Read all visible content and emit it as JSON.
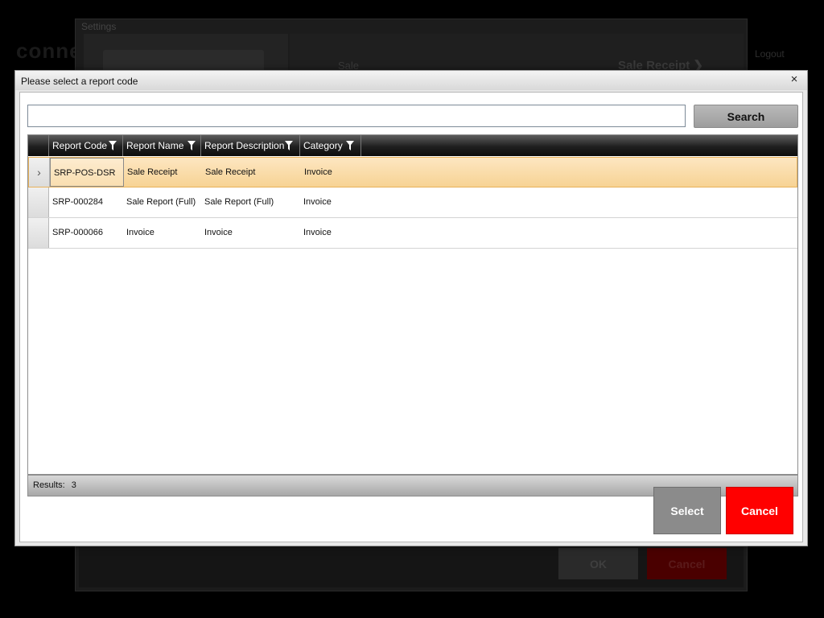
{
  "background": {
    "brand_text": "conne",
    "logout_label": "Logout",
    "settings_title": "Settings",
    "sale_label": "Sale",
    "sale_receipt_label": "Sale Receipt ❯",
    "ok_label": "OK",
    "cancel_label": "Cancel"
  },
  "dialog": {
    "title": "Please select a report code",
    "close_glyph": "×",
    "search": {
      "value": "",
      "placeholder": "",
      "button_label": "Search"
    },
    "grid": {
      "columns": [
        "Report Code",
        "Report Name",
        "Report Description",
        "Category"
      ],
      "rows": [
        {
          "code": "SRP-POS-DSR",
          "name": "Sale Receipt",
          "description": "Sale Receipt",
          "category": "Invoice",
          "selected": true
        },
        {
          "code": "SRP-000284",
          "name": "Sale Report (Full)",
          "description": "Sale Report (Full)",
          "category": "Invoice",
          "selected": false
        },
        {
          "code": "SRP-000066",
          "name": "Invoice",
          "description": "Invoice",
          "category": "Invoice",
          "selected": false
        }
      ],
      "row_indicator": "›",
      "results_label": "Results:",
      "results_count": "3"
    },
    "select_label": "Select",
    "cancel_label": "Cancel"
  },
  "colors": {
    "selected_row": "#f9d9a0",
    "cancel_button": "#ff0000",
    "select_button": "#8b8b8b"
  }
}
